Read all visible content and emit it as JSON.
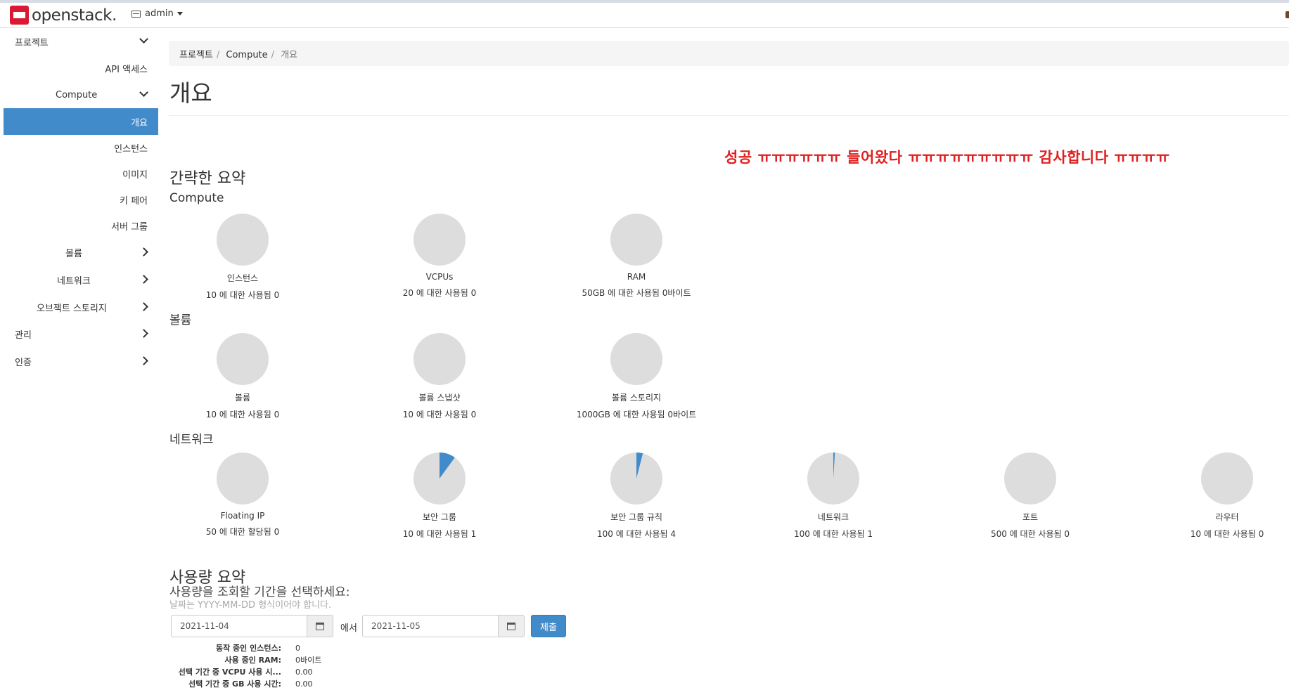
{
  "header": {
    "logo_text": "openstack.",
    "project": "admin"
  },
  "sidebar": {
    "project": "프로젝트",
    "api_access": "API 액세스",
    "compute": "Compute",
    "compute_items": [
      "개요",
      "인스턴스",
      "이미지",
      "키 페어",
      "서버 그룹"
    ],
    "volume": "볼륨",
    "network": "네트워크",
    "object_storage": "오브젝트 스토리지",
    "admin": "관리",
    "identity": "인증"
  },
  "breadcrumb": [
    "프로젝트",
    "Compute",
    "개요"
  ],
  "page_title": "개요",
  "limit_summary": {
    "heading": "간략한 요약",
    "banner": "성공 ㅠㅠㅠㅠㅠㅠ 들어왔다 ㅠㅠㅠㅠㅠㅠㅠㅠㅠ 감사합니다 ㅠㅠㅠㅠ",
    "compute_heading": "Compute",
    "volume_heading": "볼륨",
    "network_heading": "네트워크",
    "compute": [
      {
        "label": "인스턴스",
        "value": "10 에 대한 사용됨 0",
        "fraction": 0
      },
      {
        "label": "VCPUs",
        "value": "20 에 대한 사용됨 0",
        "fraction": 0
      },
      {
        "label": "RAM",
        "value": "50GB 에 대한 사용됨 0바이트",
        "fraction": 0
      }
    ],
    "volume": [
      {
        "label": "볼륨",
        "value": "10 에 대한 사용됨 0",
        "fraction": 0
      },
      {
        "label": "볼륨 스냅샷",
        "value": "10 에 대한 사용됨 0",
        "fraction": 0
      },
      {
        "label": "볼륨 스토리지",
        "value": "1000GB 에 대한 사용됨 0바이트",
        "fraction": 0
      }
    ],
    "network": [
      {
        "label": "Floating IP",
        "value": "50 에 대한 할당됨 0",
        "fraction": 0
      },
      {
        "label": "보안 그룹",
        "value": "10 에 대한 사용됨 1",
        "fraction": 0.1
      },
      {
        "label": "보안 그룹 규칙",
        "value": "100 에 대한 사용됨 4",
        "fraction": 0.04
      },
      {
        "label": "네트워크",
        "value": "100 에 대한 사용됨 1",
        "fraction": 0.01
      },
      {
        "label": "포트",
        "value": "500 에 대한 사용됨 0",
        "fraction": 0
      },
      {
        "label": "라우터",
        "value": "10 에 대한 사용됨 0",
        "fraction": 0
      }
    ]
  },
  "usage": {
    "heading": "사용량 요약",
    "prompt": "사용량을 조회할 기간을 선택하세요:",
    "hint": "날짜는 YYYY-MM-DD 형식이어야 합니다.",
    "start_date": "2021-11-04",
    "from_label": "에서",
    "end_date": "2021-11-05",
    "submit": "제출",
    "stats": [
      {
        "key": "동작 중인 인스턴스:",
        "value": "0"
      },
      {
        "key": "사용 중인 RAM:",
        "value": "0바이트"
      },
      {
        "key": "선택 기간 중 VCPU 사용 시...",
        "value": "0.00"
      },
      {
        "key": "선택 기간 중 GB 사용 시간:",
        "value": "0.00"
      }
    ]
  },
  "colors": {
    "accent": "#428bca",
    "pie_bg": "#dddddd",
    "banner": "#e02020"
  }
}
